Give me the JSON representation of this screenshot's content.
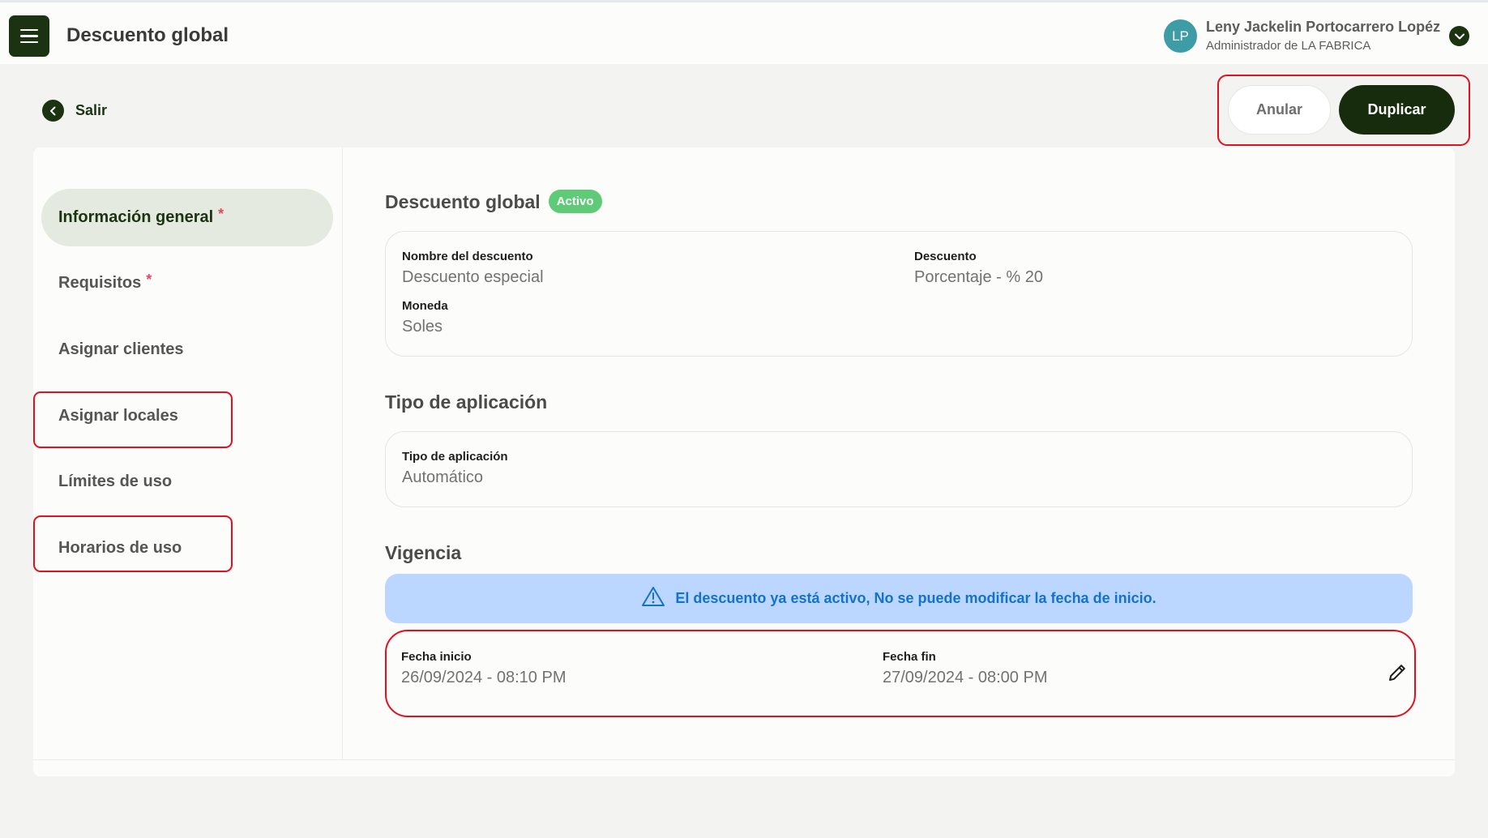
{
  "header": {
    "title": "Descuento global",
    "user": {
      "initials": "LP",
      "name": "Leny Jackelin Portocarrero Lopéz",
      "role": "Administrador de LA FABRICA"
    }
  },
  "back": {
    "label": "Salir"
  },
  "actions": {
    "cancel_label": "Anular",
    "duplicate_label": "Duplicar"
  },
  "sidebar": {
    "items": [
      {
        "label": "Información general",
        "required": "*"
      },
      {
        "label": "Requisitos",
        "required": "*"
      },
      {
        "label": "Asignar clientes"
      },
      {
        "label": "Asignar locales"
      },
      {
        "label": "Límites de uso"
      },
      {
        "label": "Horarios de uso"
      }
    ]
  },
  "general": {
    "title": "Descuento global",
    "status": "Activo",
    "fields": {
      "name_label": "Nombre del descuento",
      "name_value": "Descuento especial",
      "discount_label": "Descuento",
      "discount_value": "Porcentaje - % 20",
      "currency_label": "Moneda",
      "currency_value": "Soles"
    }
  },
  "application": {
    "title": "Tipo de aplicación",
    "label": "Tipo de aplicación",
    "value": "Automático"
  },
  "validity": {
    "title": "Vigencia",
    "alert": "El descuento ya está activo, No se puede modificar la fecha de inicio.",
    "start_label": "Fecha inicio",
    "start_value": "26/09/2024 - 08:10 PM",
    "end_label": "Fecha fin",
    "end_value": "27/09/2024 - 08:00 PM"
  },
  "colors": {
    "primary": "#1b3310",
    "highlight": "#e3101d",
    "badge": "#5fcb78",
    "alert_bg": "#bbd6ff",
    "alert_text": "#1473c9"
  }
}
